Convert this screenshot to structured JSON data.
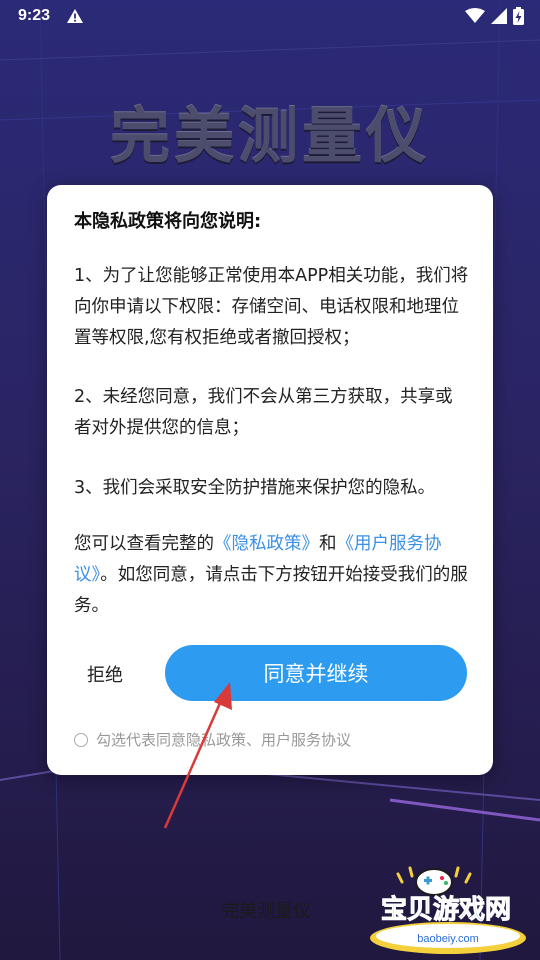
{
  "status_bar": {
    "time": "9:23",
    "warning_icon": "warning-icon",
    "wifi_icon": "wifi-icon",
    "signal_icon": "signal-icon",
    "battery_icon": "battery-charging-icon"
  },
  "app": {
    "title": "完美测量仪",
    "footer_name": "完美测量仪"
  },
  "dialog": {
    "heading": "本隐私政策将向您说明:",
    "para1": "1、为了让您能够正常使用本APP相关功能，我们将向你申请以下权限：存储空间、电话权限和地理位置等权限,您有权拒绝或者撤回授权；",
    "para2": "2、未经您同意，我们不会从第三方获取，共享或者对外提供您的信息；",
    "para3": "3、我们会采取安全防护措施来保护您的隐私。",
    "para4": {
      "prefix": "您可以查看完整的",
      "privacy_link": "《隐私政策》",
      "and": "和",
      "terms_link": "《用户服务协议》",
      "suffix": "。如您同意，请点击下方按钮开始接受我们的服务。"
    },
    "reject_label": "拒绝",
    "agree_label": "同意并继续",
    "consent_text": "勾选代表同意隐私政策、用户服务协议",
    "consent_checked": false
  },
  "watermark": {
    "text": "宝贝游戏网",
    "url": "baobeiy.com"
  },
  "colors": {
    "accent": "#2c9bf0",
    "link": "#3a8fe6",
    "arrow": "#d93a3a"
  }
}
